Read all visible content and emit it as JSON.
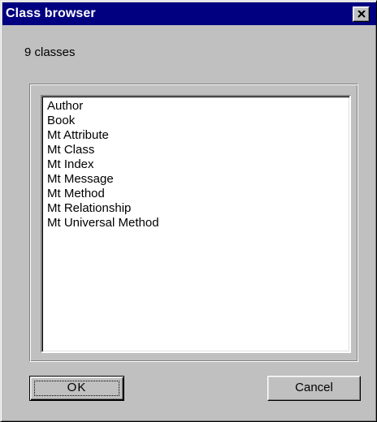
{
  "window": {
    "title": "Class browser"
  },
  "header": {
    "count_label": "9 classes"
  },
  "class_list": {
    "items": [
      "Author",
      "Book",
      "Mt Attribute",
      "Mt Class",
      "Mt Index",
      "Mt Message",
      "Mt Method",
      "Mt Relationship",
      "Mt Universal Method"
    ]
  },
  "buttons": {
    "ok_label": "OK",
    "cancel_label": "Cancel"
  },
  "icons": {
    "close": "close-icon"
  },
  "colors": {
    "titlebar": "#000080",
    "face": "#c0c0c0",
    "list_background": "#ffffff"
  }
}
